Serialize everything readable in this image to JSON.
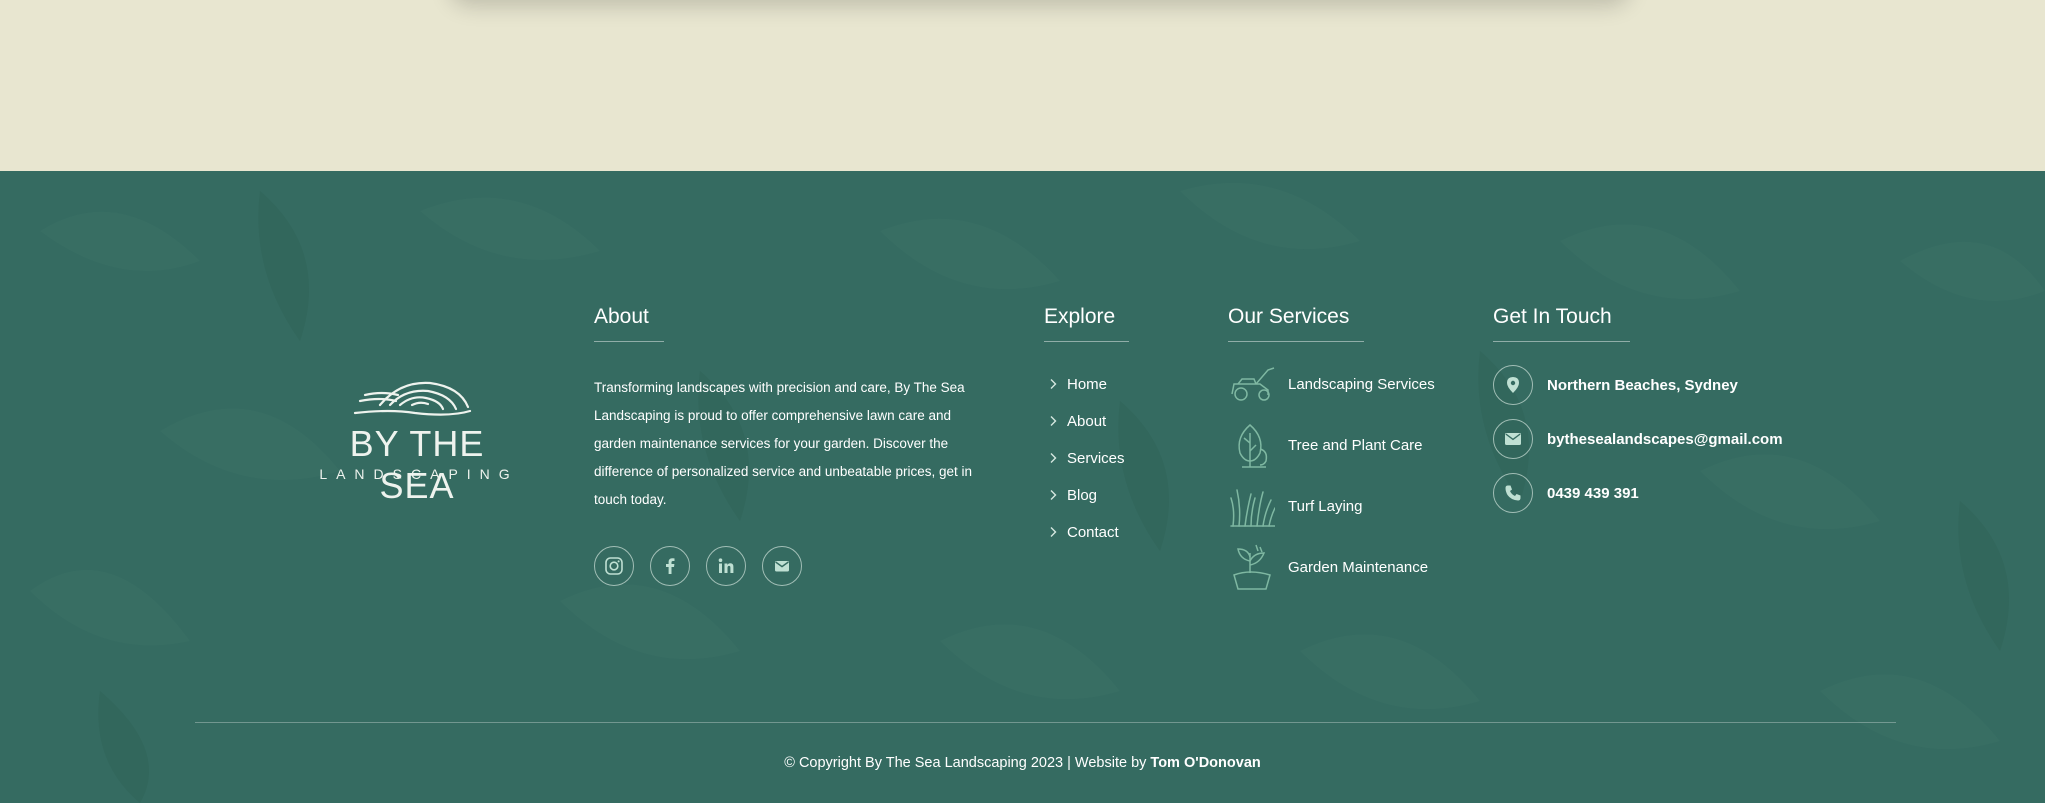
{
  "brand": {
    "logo_title": "BY THE SEA",
    "logo_sub": "LANDSCAPING",
    "colors": {
      "footer_bg": "#356b61",
      "top_bg": "#e8e6d0",
      "text": "#ffffff"
    }
  },
  "about": {
    "heading": "About",
    "text": "Transforming landscapes with precision and care, By The Sea Landscaping is proud to offer comprehensive lawn care and garden maintenance services for your garden. Discover the difference of personalized service and unbeatable prices, get in touch today.",
    "social": [
      {
        "icon": "instagram-icon"
      },
      {
        "icon": "facebook-icon"
      },
      {
        "icon": "linkedin-icon"
      },
      {
        "icon": "email-icon"
      }
    ]
  },
  "explore": {
    "heading": "Explore",
    "items": [
      {
        "label": "Home"
      },
      {
        "label": "About"
      },
      {
        "label": "Services"
      },
      {
        "label": "Blog"
      },
      {
        "label": "Contact"
      }
    ]
  },
  "services": {
    "heading": "Our Services",
    "items": [
      {
        "label": "Landscaping Services",
        "icon": "lawn-mower-icon"
      },
      {
        "label": "Tree and Plant Care",
        "icon": "tree-icon"
      },
      {
        "label": "Turf Laying",
        "icon": "grass-icon"
      },
      {
        "label": "Garden Maintenance",
        "icon": "plant-pot-icon"
      }
    ]
  },
  "contact": {
    "heading": "Get In Touch",
    "items": [
      {
        "label": "Northern Beaches, Sydney",
        "icon": "location-pin-icon"
      },
      {
        "label": "bythesealandscapes@gmail.com",
        "icon": "email-icon"
      },
      {
        "label": "0439 439 391",
        "icon": "phone-icon"
      }
    ]
  },
  "footer": {
    "copyright": "© Copyright By The Sea Landscaping 2023 | Website by ",
    "author": "Tom O'Donovan"
  }
}
